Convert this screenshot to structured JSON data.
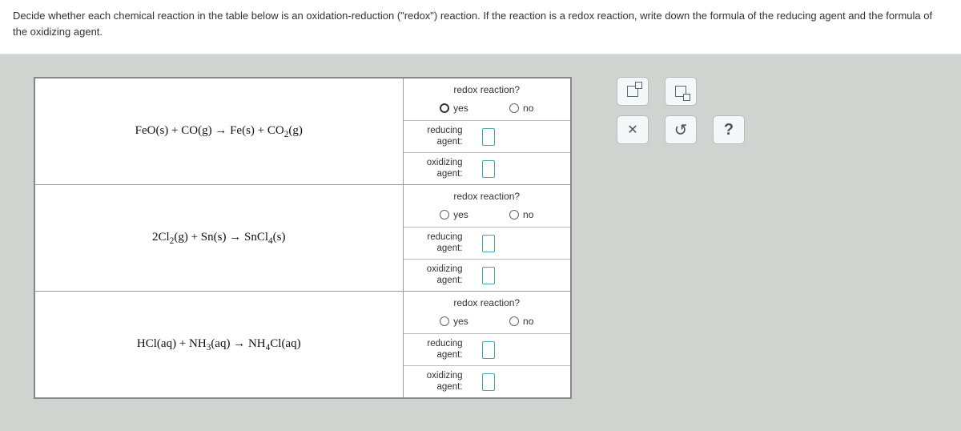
{
  "question": "Decide whether each chemical reaction in the table below is an oxidation-reduction (\"redox\") reaction. If the reaction is a redox reaction, write down the formula of the reducing agent and the formula of the oxidizing agent.",
  "labels": {
    "redox_header": "redox reaction?",
    "yes": "yes",
    "no": "no",
    "reducing": "reducing agent:",
    "oxidizing": "oxidizing agent:"
  },
  "reactions": [
    {
      "equation_html": "FeO(s) + CO(g) → Fe(s) + CO<sub>2</sub>(g)",
      "yes_hover": true
    },
    {
      "equation_html": "2Cl<sub>2</sub>(g) + Sn(s) → SnCl<sub>4</sub>(s)",
      "yes_hover": false
    },
    {
      "equation_html": "HCl(aq) + NH<sub>3</sub>(aq) → NH<sub>4</sub>Cl(aq)",
      "yes_hover": false
    }
  ],
  "tools": {
    "superscript": "superscript",
    "subscript": "subscript",
    "close": "close",
    "reset": "reset",
    "help": "help"
  }
}
